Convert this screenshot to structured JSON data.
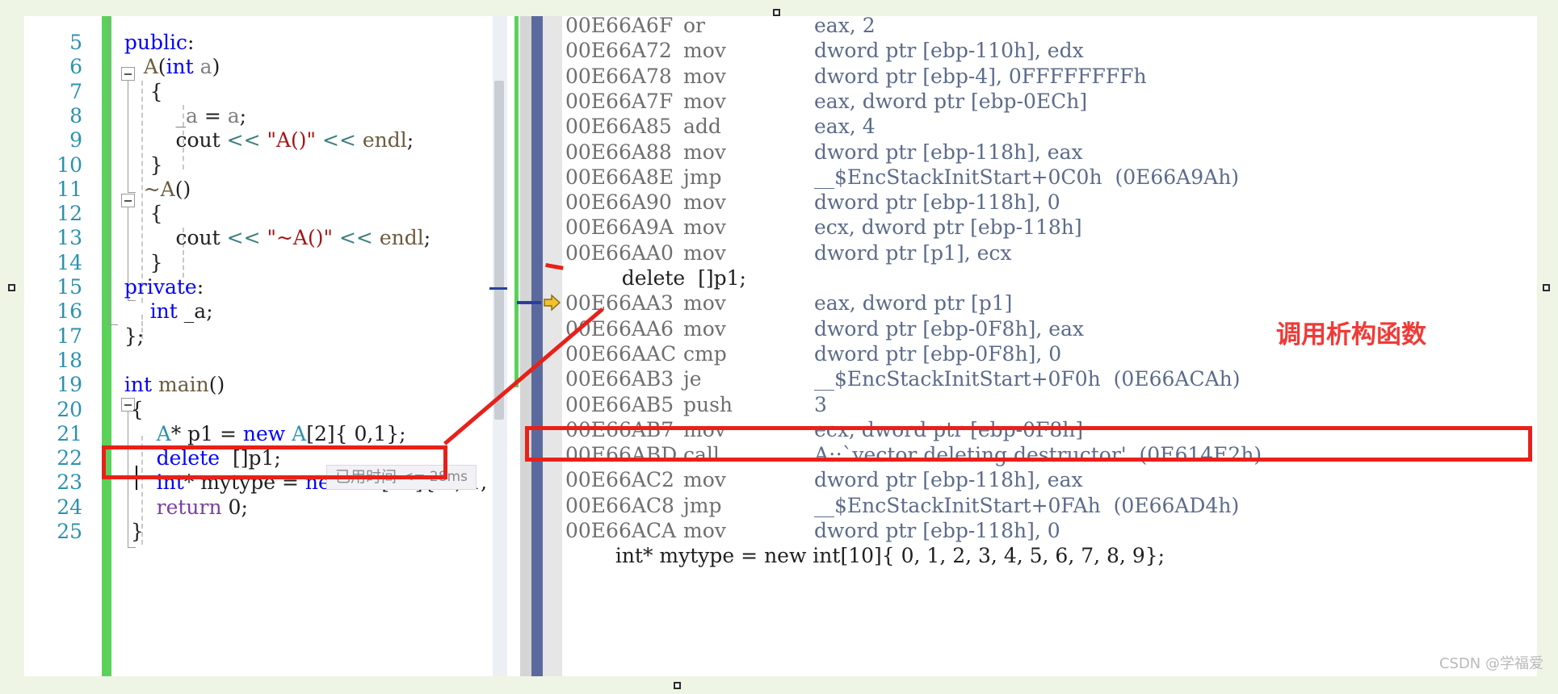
{
  "editor": {
    "pane_name": "source-code-editor",
    "lines": [
      {
        "num": "5",
        "segments": [
          {
            "t": "  ",
            "c": "blk"
          },
          {
            "t": "public",
            "c": "kw"
          },
          {
            "t": ":",
            "c": "blk"
          }
        ]
      },
      {
        "num": "6",
        "segments": [
          {
            "t": "     ",
            "c": "blk"
          },
          {
            "t": "A",
            "c": "pln"
          },
          {
            "t": "(",
            "c": "blk"
          },
          {
            "t": "int",
            "c": "kw"
          },
          {
            "t": " ",
            "c": "blk"
          },
          {
            "t": "a",
            "c": "gray"
          },
          {
            "t": ")",
            "c": "blk"
          }
        ]
      },
      {
        "num": "7",
        "segments": [
          {
            "t": "      {",
            "c": "blk"
          }
        ]
      },
      {
        "num": "8",
        "segments": [
          {
            "t": "          _a ",
            "c": "gray"
          },
          {
            "t": "= ",
            "c": "blk"
          },
          {
            "t": "a",
            "c": "gray"
          },
          {
            "t": ";",
            "c": "blk"
          }
        ]
      },
      {
        "num": "9",
        "segments": [
          {
            "t": "          cout ",
            "c": "blk"
          },
          {
            "t": "<<",
            "c": "op"
          },
          {
            "t": " ",
            "c": "blk"
          },
          {
            "t": "\"A()\"",
            "c": "str"
          },
          {
            "t": " ",
            "c": "blk"
          },
          {
            "t": "<<",
            "c": "op"
          },
          {
            "t": " ",
            "c": "blk"
          },
          {
            "t": "endl",
            "c": "pln"
          },
          {
            "t": ";",
            "c": "blk"
          }
        ]
      },
      {
        "num": "10",
        "segments": [
          {
            "t": "      }",
            "c": "blk"
          }
        ]
      },
      {
        "num": "11",
        "segments": [
          {
            "t": "     ",
            "c": "blk"
          },
          {
            "t": "~A",
            "c": "pln"
          },
          {
            "t": "()",
            "c": "blk"
          }
        ]
      },
      {
        "num": "12",
        "segments": [
          {
            "t": "      {",
            "c": "blk"
          }
        ]
      },
      {
        "num": "13",
        "segments": [
          {
            "t": "          cout ",
            "c": "blk"
          },
          {
            "t": "<<",
            "c": "op"
          },
          {
            "t": " ",
            "c": "blk"
          },
          {
            "t": "\"~A()\"",
            "c": "str"
          },
          {
            "t": " ",
            "c": "blk"
          },
          {
            "t": "<<",
            "c": "op"
          },
          {
            "t": " ",
            "c": "blk"
          },
          {
            "t": "endl",
            "c": "pln"
          },
          {
            "t": ";",
            "c": "blk"
          }
        ]
      },
      {
        "num": "14",
        "segments": [
          {
            "t": "      }",
            "c": "blk"
          }
        ]
      },
      {
        "num": "15",
        "segments": [
          {
            "t": "  ",
            "c": "blk"
          },
          {
            "t": "private",
            "c": "kw"
          },
          {
            "t": ":",
            "c": "blk"
          }
        ]
      },
      {
        "num": "16",
        "segments": [
          {
            "t": "      ",
            "c": "blk"
          },
          {
            "t": "int",
            "c": "kw"
          },
          {
            "t": " _a;",
            "c": "blk"
          }
        ]
      },
      {
        "num": "17",
        "segments": [
          {
            "t": "  };",
            "c": "blk"
          }
        ]
      },
      {
        "num": "18",
        "segments": []
      },
      {
        "num": "19",
        "segments": [
          {
            "t": "  ",
            "c": "blk"
          },
          {
            "t": "int",
            "c": "kw"
          },
          {
            "t": " ",
            "c": "blk"
          },
          {
            "t": "main",
            "c": "pln"
          },
          {
            "t": "()",
            "c": "blk"
          }
        ]
      },
      {
        "num": "20",
        "segments": [
          {
            "t": "   {",
            "c": "blk"
          }
        ]
      },
      {
        "num": "21",
        "segments": [
          {
            "t": "       ",
            "c": "blk"
          },
          {
            "t": "A",
            "c": "typ"
          },
          {
            "t": "* p1 = ",
            "c": "blk"
          },
          {
            "t": "new",
            "c": "kw"
          },
          {
            "t": " ",
            "c": "blk"
          },
          {
            "t": "A",
            "c": "typ"
          },
          {
            "t": "[2]{ 0,1};",
            "c": "blk"
          }
        ]
      },
      {
        "num": "22",
        "segments": [
          {
            "t": "       ",
            "c": "blk"
          },
          {
            "t": "delete",
            "c": "kw"
          },
          {
            "t": "  []p1;",
            "c": "blk"
          }
        ]
      },
      {
        "num": "23",
        "segments": [
          {
            "t": "       ",
            "c": "blk"
          },
          {
            "t": "int",
            "c": "kw"
          },
          {
            "t": "* mytype = ",
            "c": "blk"
          },
          {
            "t": "new",
            "c": "kw"
          },
          {
            "t": " ",
            "c": "blk"
          },
          {
            "t": "int",
            "c": "kw"
          },
          {
            "t": "[10]{ 0, 1, 2,",
            "c": "blk"
          }
        ]
      },
      {
        "num": "24",
        "segments": [
          {
            "t": "       ",
            "c": "blk"
          },
          {
            "t": "return",
            "c": "kw2"
          },
          {
            "t": " 0;",
            "c": "blk"
          }
        ]
      },
      {
        "num": "25",
        "segments": [
          {
            "t": "   }",
            "c": "blk"
          }
        ]
      }
    ],
    "tooltip": {
      "cn_text": "已用时间",
      "en_text": "<= 28ms"
    }
  },
  "disassembly": {
    "pane_name": "disassembly-view",
    "rows": [
      {
        "kind": "asm",
        "addr": "00E66A6F",
        "mn": "or",
        "ops": "eax, 2",
        "clipped": true
      },
      {
        "kind": "asm",
        "addr": "00E66A72",
        "mn": "mov",
        "ops": "dword ptr [ebp-110h], edx"
      },
      {
        "kind": "asm",
        "addr": "00E66A78",
        "mn": "mov",
        "ops": "dword ptr [ebp-4], 0FFFFFFFFh"
      },
      {
        "kind": "asm",
        "addr": "00E66A7F",
        "mn": "mov",
        "ops": "eax, dword ptr [ebp-0ECh]"
      },
      {
        "kind": "asm",
        "addr": "00E66A85",
        "mn": "add",
        "ops": "eax, 4"
      },
      {
        "kind": "asm",
        "addr": "00E66A88",
        "mn": "mov",
        "ops": "dword ptr [ebp-118h], eax"
      },
      {
        "kind": "asm",
        "addr": "00E66A8E",
        "mn": "jmp",
        "ops": "__$EncStackInitStart+0C0h  (0E66A9Ah)"
      },
      {
        "kind": "asm",
        "addr": "00E66A90",
        "mn": "mov",
        "ops": "dword ptr [ebp-118h], 0"
      },
      {
        "kind": "asm",
        "addr": "00E66A9A",
        "mn": "mov",
        "ops": "ecx, dword ptr [ebp-118h]"
      },
      {
        "kind": "asm",
        "addr": "00E66AA0",
        "mn": "mov",
        "ops": "dword ptr [p1], ecx"
      },
      {
        "kind": "src",
        "src": "    delete  []p1;"
      },
      {
        "kind": "asm",
        "addr": "00E66AA3",
        "mn": "mov",
        "ops": "eax, dword ptr [p1]",
        "current": true
      },
      {
        "kind": "asm",
        "addr": "00E66AA6",
        "mn": "mov",
        "ops": "dword ptr [ebp-0F8h], eax"
      },
      {
        "kind": "asm",
        "addr": "00E66AAC",
        "mn": "cmp",
        "ops": "dword ptr [ebp-0F8h], 0"
      },
      {
        "kind": "asm",
        "addr": "00E66AB3",
        "mn": "je",
        "ops": "__$EncStackInitStart+0F0h  (0E66ACAh)"
      },
      {
        "kind": "asm",
        "addr": "00E66AB5",
        "mn": "push",
        "ops": "3"
      },
      {
        "kind": "asm",
        "addr": "00E66AB7",
        "mn": "mov",
        "ops": "ecx, dword ptr [ebp-0F8h]"
      },
      {
        "kind": "asm",
        "addr": "00E66ABD",
        "mn": "call",
        "ops": "A::`vector deleting destructor'  (0E614E2h)",
        "boxed": true
      },
      {
        "kind": "asm",
        "addr": "00E66AC2",
        "mn": "mov",
        "ops": "dword ptr [ebp-118h], eax"
      },
      {
        "kind": "asm",
        "addr": "00E66AC8",
        "mn": "jmp",
        "ops": "__$EncStackInitStart+0FAh  (0E66AD4h)"
      },
      {
        "kind": "asm",
        "addr": "00E66ACA",
        "mn": "mov",
        "ops": "dword ptr [ebp-118h], 0"
      },
      {
        "kind": "src",
        "src": "   int* mytype = new int[10]{ 0, 1, 2, 3, 4, 5, 6, 7, 8, 9};"
      }
    ]
  },
  "annotations": {
    "chinese_note": "调用析构函数"
  },
  "watermark": {
    "text": "CSDN @学福爱"
  },
  "colors": {
    "accent_red": "#e8201a",
    "note_red": "#f03a36",
    "keyword_blue": "#0000ff",
    "string_red": "#a31515",
    "linenumber_blue": "#2b91af",
    "changebar_green": "#5ad25a",
    "disasm_operand": "#5c6b8a"
  }
}
